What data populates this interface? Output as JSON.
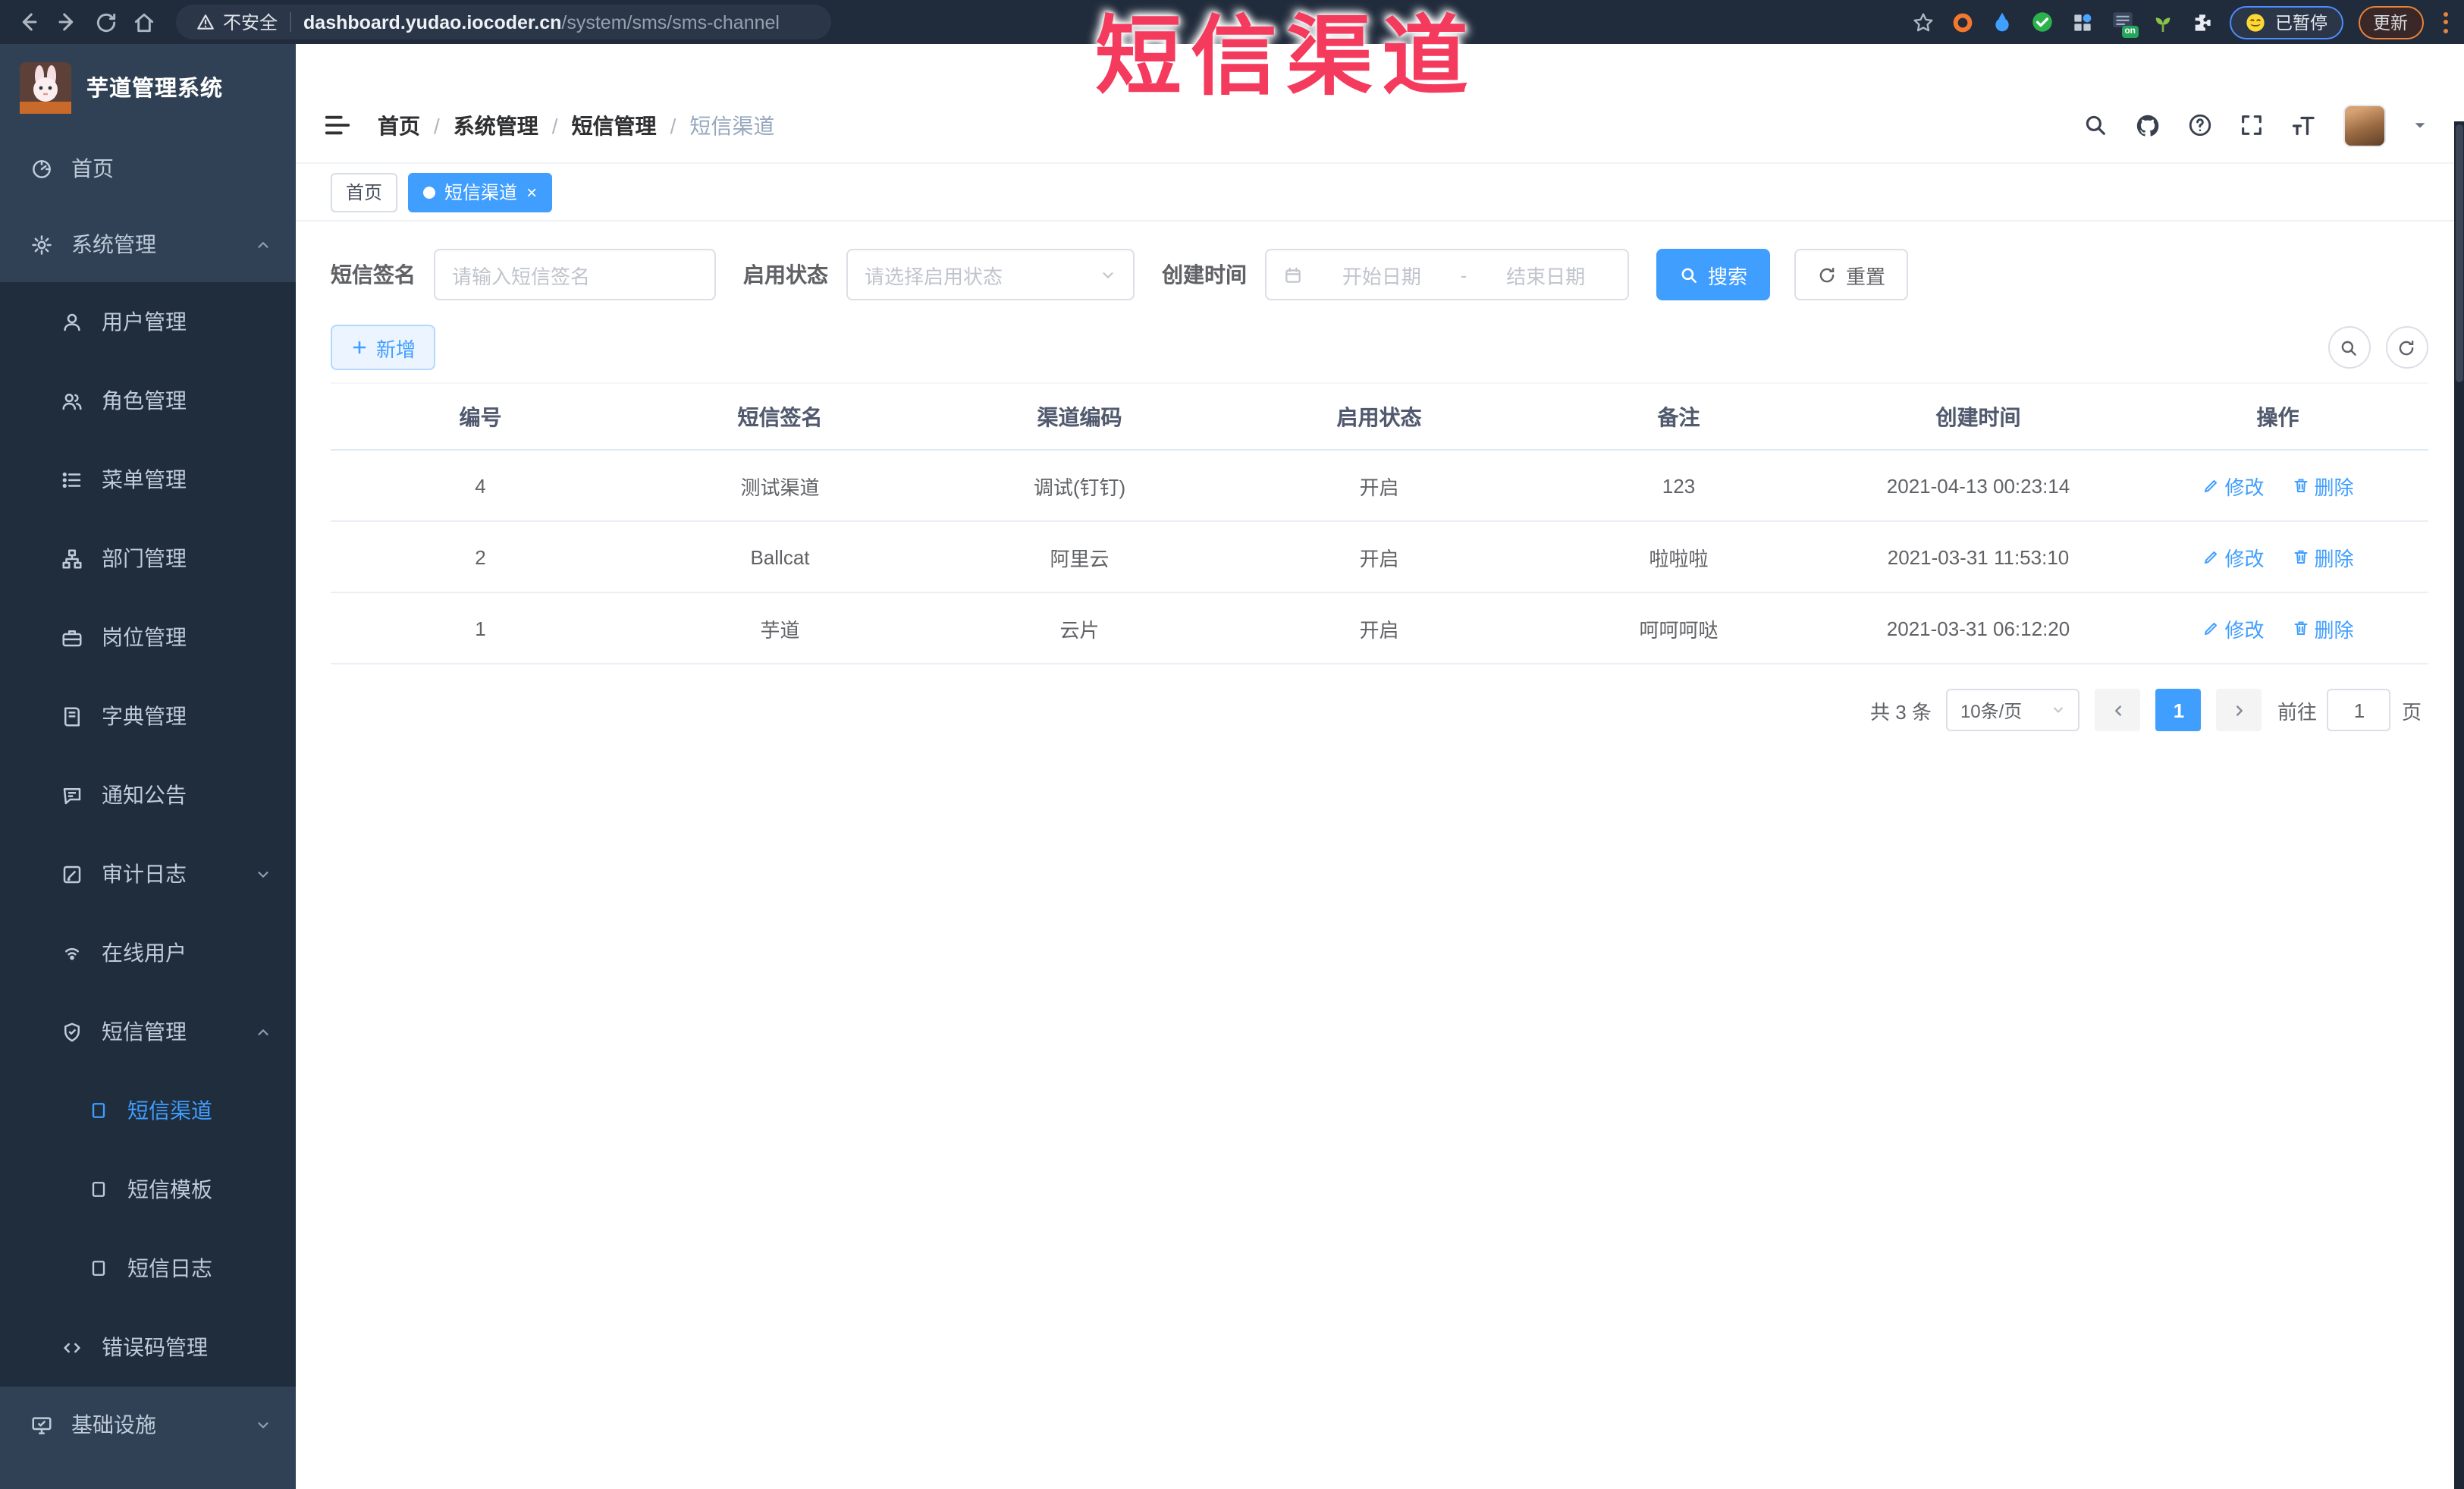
{
  "overlay": {
    "annotation": "短信渠道"
  },
  "browser": {
    "security_warning": "不安全",
    "url_domain": "dashboard.yudao.iocoder.cn",
    "url_path": "/system/sms/sms-channel",
    "extension_on_badge": "on",
    "paused_badge": "已暂停",
    "update_button": "更新"
  },
  "sidebar": {
    "app_title": "芋道管理系统",
    "items": [
      {
        "label": "首页"
      },
      {
        "label": "系统管理",
        "chevron": "up"
      },
      {
        "label": "用户管理"
      },
      {
        "label": "角色管理"
      },
      {
        "label": "菜单管理"
      },
      {
        "label": "部门管理"
      },
      {
        "label": "岗位管理"
      },
      {
        "label": "字典管理"
      },
      {
        "label": "通知公告"
      },
      {
        "label": "审计日志",
        "chevron": "down"
      },
      {
        "label": "在线用户"
      },
      {
        "label": "短信管理",
        "chevron": "up"
      },
      {
        "label": "短信渠道",
        "active": true
      },
      {
        "label": "短信模板"
      },
      {
        "label": "短信日志"
      },
      {
        "label": "错误码管理"
      },
      {
        "label": "基础设施",
        "chevron": "down"
      }
    ]
  },
  "header": {
    "breadcrumb": [
      "首页",
      "系统管理",
      "短信管理",
      "短信渠道"
    ]
  },
  "tags": {
    "home": "首页",
    "active": "短信渠道"
  },
  "search": {
    "sign_label": "短信签名",
    "sign_placeholder": "请输入短信签名",
    "status_label": "启用状态",
    "status_placeholder": "请选择启用状态",
    "time_label": "创建时间",
    "start_placeholder": "开始日期",
    "range_separator": "-",
    "end_placeholder": "结束日期",
    "search_button": "搜索",
    "reset_button": "重置"
  },
  "toolbar": {
    "add_button": "新增"
  },
  "table": {
    "columns": [
      "编号",
      "短信签名",
      "渠道编码",
      "启用状态",
      "备注",
      "创建时间",
      "操作"
    ],
    "rows": [
      {
        "id": "4",
        "sign": "测试渠道",
        "code": "调试(钉钉)",
        "status": "开启",
        "remark": "123",
        "created": "2021-04-13 00:23:14"
      },
      {
        "id": "2",
        "sign": "Ballcat",
        "code": "阿里云",
        "status": "开启",
        "remark": "啦啦啦",
        "created": "2021-03-31 11:53:10"
      },
      {
        "id": "1",
        "sign": "芋道",
        "code": "云片",
        "status": "开启",
        "remark": "呵呵呵哒",
        "created": "2021-03-31 06:12:20"
      }
    ],
    "actions": {
      "edit": "修改",
      "delete": "删除"
    }
  },
  "pagination": {
    "total": "共 3 条",
    "page_size": "10条/页",
    "page": "1",
    "goto_label": "前往",
    "goto_value": "1",
    "page_label": "页"
  },
  "colors": {
    "accent": "#409eff",
    "sidebar_bg": "#304156",
    "submenu_bg": "#1f2d3d",
    "annotation": "#f43b5e"
  }
}
